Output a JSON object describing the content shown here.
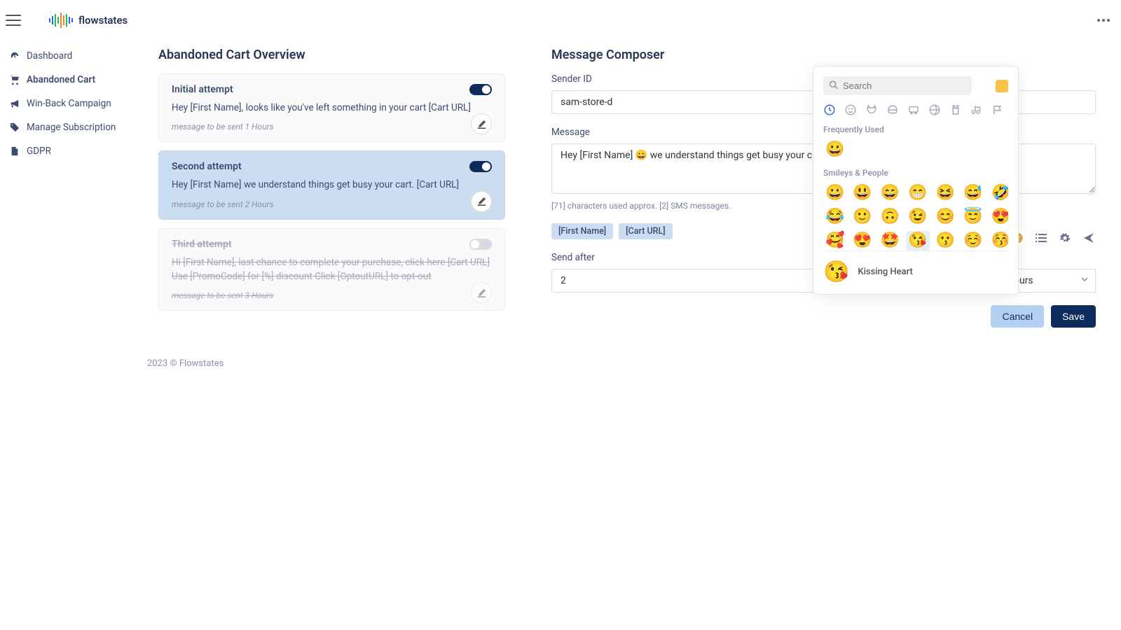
{
  "brand": "flowstates",
  "sidebar": {
    "items": [
      {
        "label": "Dashboard",
        "icon": "dashboard"
      },
      {
        "label": "Abandoned Cart",
        "icon": "cart",
        "active": true
      },
      {
        "label": "Win-Back Campaign",
        "icon": "bullhorn"
      },
      {
        "label": "Manage Subscription",
        "icon": "tags"
      },
      {
        "label": "GDPR",
        "icon": "file"
      }
    ]
  },
  "overview": {
    "title": "Abandoned Cart Overview",
    "attempts": [
      {
        "title": "Initial attempt",
        "body": "Hey [First Name], looks like you've left something in your cart [Cart URL]",
        "footer": "message to be sent 1 Hours",
        "enabled": true,
        "selected": false
      },
      {
        "title": "Second attempt",
        "body": "Hey [First Name] we understand things get busy your cart. [Cart URL]",
        "footer": "message to be sent 2 Hours",
        "enabled": true,
        "selected": true
      },
      {
        "title": "Third attempt",
        "body": "Hi [First Name], last chance to complete your purchase, click here [Cart URL] Use [PromoCode] for [%] discount Click [OptoutURL] to opt-out",
        "footer": "message to be sent 3 Hours",
        "enabled": false,
        "selected": false
      }
    ]
  },
  "composer": {
    "title": "Message Composer",
    "senderLabel": "Sender ID",
    "senderValue": "sam-store-d",
    "messageLabel": "Message",
    "messageValue": "Hey [First Name] 😀 we understand things get busy your cart. [Cart URL]",
    "hint": "[71] characters used approx. [2] SMS messages.",
    "chips": [
      "[First Name]",
      "[Cart URL]"
    ],
    "sendAfterLabel": "Send after",
    "sendAfterValue": "2",
    "sendAfterUnit": "Hours",
    "cancel": "Cancel",
    "save": "Save"
  },
  "emoji": {
    "searchPlaceholder": "Search",
    "freqTitle": "Frequently Used",
    "freq": [
      "😀"
    ],
    "smileyTitle": "Smileys & People",
    "row1": [
      "😀",
      "😃",
      "😄",
      "😁",
      "😆",
      "😅",
      "🤣"
    ],
    "row2": [
      "😂",
      "🙂",
      "🙃",
      "😉",
      "😊",
      "😇",
      "😍"
    ],
    "row3": [
      "🥰",
      "😍",
      "🤩",
      "😘",
      "😗",
      "☺️",
      "😚"
    ],
    "previewName": "Kissing Heart",
    "previewEmoji": "😘"
  },
  "footer": "2023 © Flowstates"
}
